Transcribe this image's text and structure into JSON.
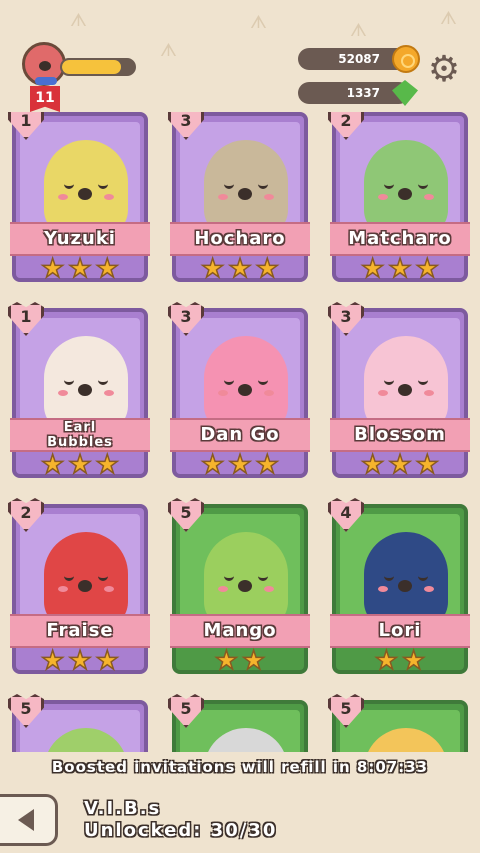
{
  "player": {
    "level": "11",
    "xp_fraction": 0.82
  },
  "currency": {
    "coins": "52087",
    "coins_icon": "coin-icon",
    "gems": "1337",
    "gems_icon": "gem-icon"
  },
  "settings_icon": "gear-icon",
  "cards": [
    {
      "name": "Yuzuki",
      "hearts": "1",
      "stars": 3,
      "bg": "purple",
      "body": "#e9d766"
    },
    {
      "name": "Hocharo",
      "hearts": "3",
      "stars": 3,
      "bg": "purple",
      "body": "#c9b89a"
    },
    {
      "name": "Matcharo",
      "hearts": "2",
      "stars": 3,
      "bg": "purple",
      "body": "#8fc776"
    },
    {
      "name": "Earl\nBubbles",
      "hearts": "1",
      "stars": 3,
      "bg": "purple",
      "body": "#f4e8de"
    },
    {
      "name": "Dan Go",
      "hearts": "3",
      "stars": 3,
      "bg": "purple",
      "body": "#f592b2"
    },
    {
      "name": "Blossom",
      "hearts": "3",
      "stars": 3,
      "bg": "purple",
      "body": "#f7c4d4"
    },
    {
      "name": "Fraise",
      "hearts": "2",
      "stars": 3,
      "bg": "purple",
      "body": "#e04646"
    },
    {
      "name": "Mango",
      "hearts": "5",
      "stars": 2,
      "bg": "green",
      "body": "#9bcf5e"
    },
    {
      "name": "Lori",
      "hearts": "4",
      "stars": 2,
      "bg": "green",
      "body": "#2f4a86"
    },
    {
      "name": "",
      "hearts": "5",
      "stars": 0,
      "bg": "purple",
      "body": "#9fcf6a"
    },
    {
      "name": "",
      "hearts": "5",
      "stars": 0,
      "bg": "green",
      "body": "#d8d8d8"
    },
    {
      "name": "",
      "hearts": "5",
      "stars": 0,
      "bg": "green",
      "body": "#f3c55a"
    }
  ],
  "notice": "Boosted invitations will refill in 8:07:33",
  "footer": {
    "title": "V.I.B.s",
    "unlocked": "Unlocked: 30/30"
  },
  "colors": {
    "purple_card": "#a97fd0",
    "green_card": "#4f9a46",
    "star": "#f6b42c",
    "ribbon": "#f2a0b4"
  }
}
